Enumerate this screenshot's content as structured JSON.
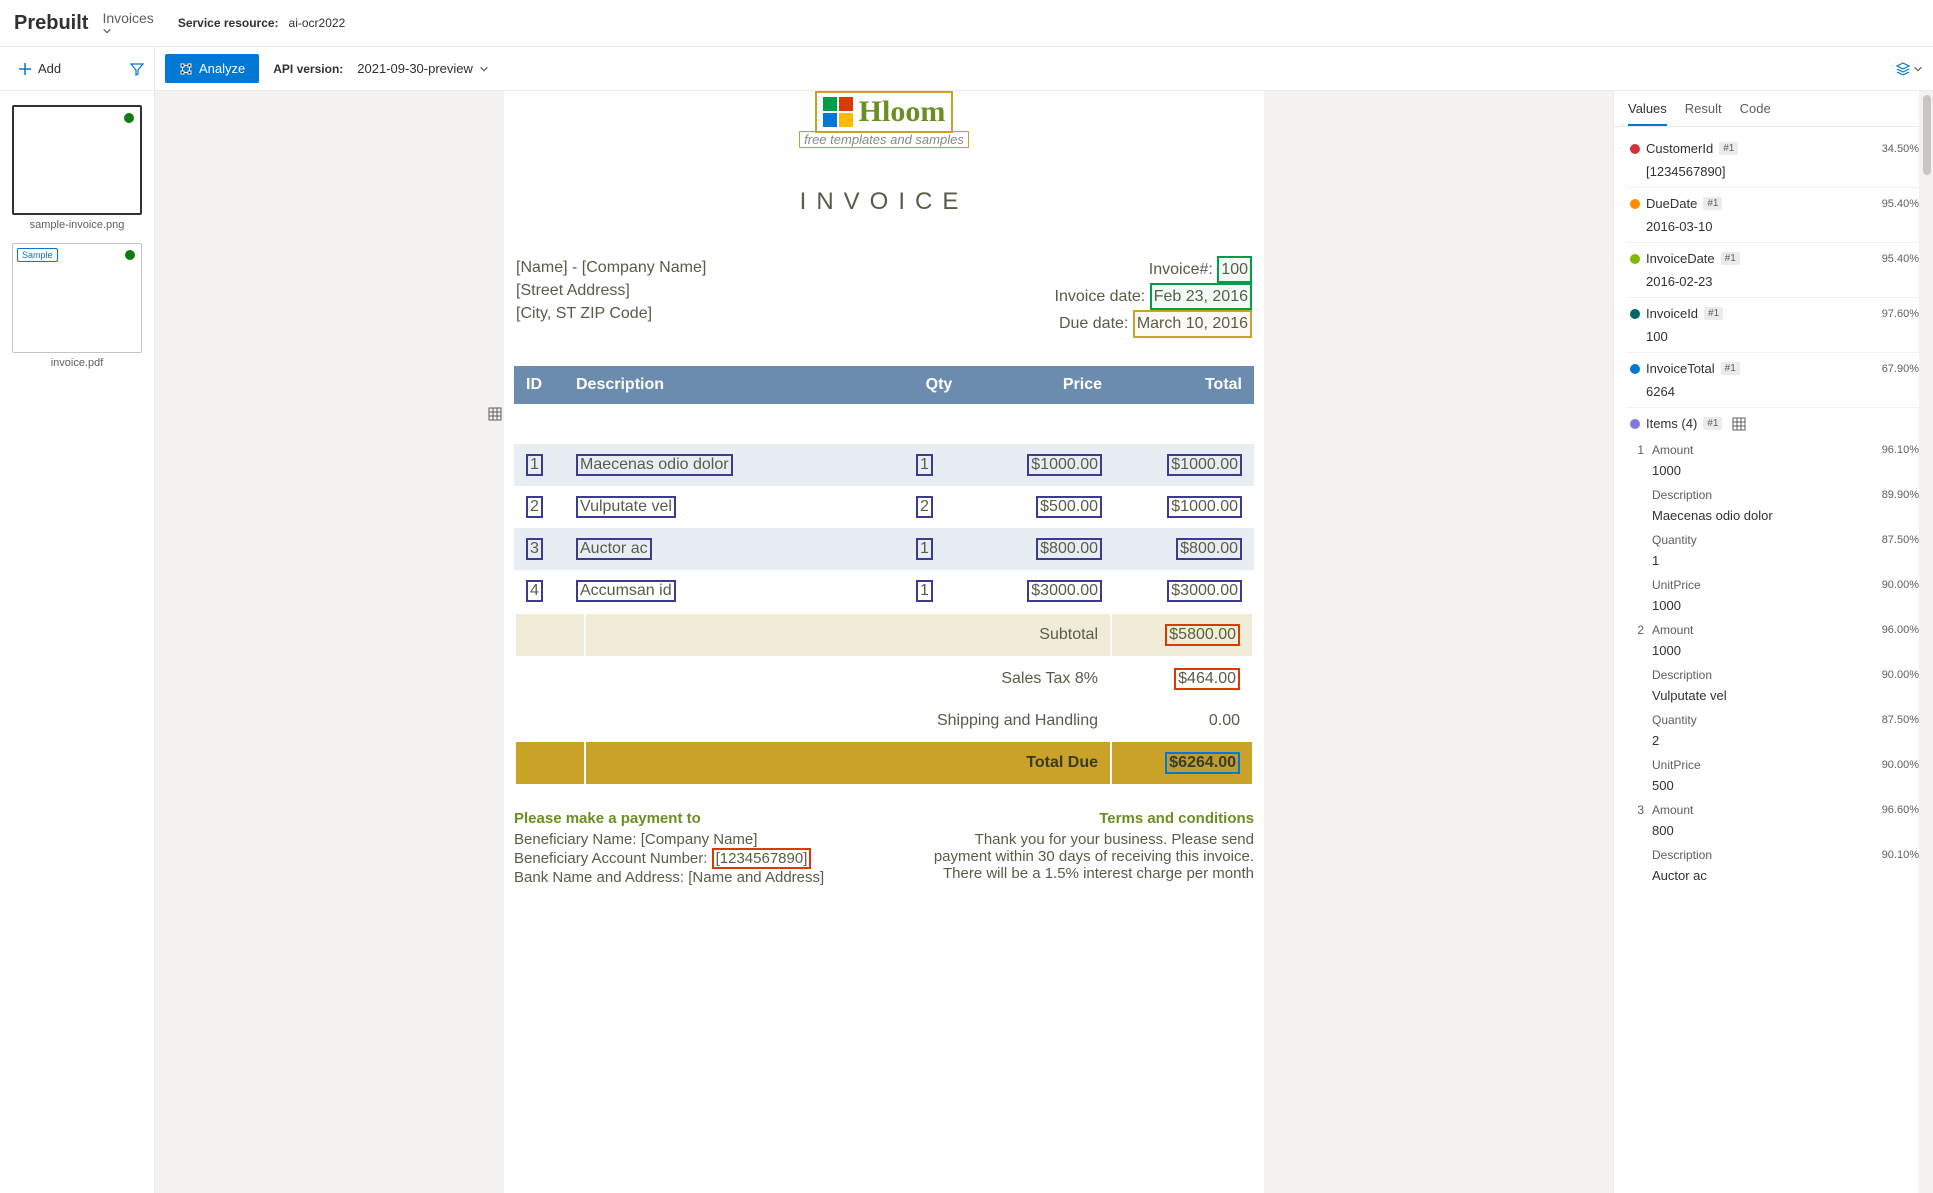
{
  "header": {
    "title": "Prebuilt",
    "crumb": "Invoices",
    "svc_label": "Service resource:",
    "svc_value": "ai-ocr2022"
  },
  "toolbar": {
    "add": "Add",
    "analyze": "Analyze",
    "api_label": "API version:",
    "api_value": "2021-09-30-preview"
  },
  "thumbs": [
    {
      "label": "sample-invoice.png",
      "selected": true,
      "sample": false
    },
    {
      "label": "invoice.pdf",
      "selected": false,
      "sample": true
    }
  ],
  "doc": {
    "logo_text": "Hloom",
    "logo_sub": "free templates and samples",
    "title": "INVOICE",
    "meta_left": [
      "[Name] - [Company Name]",
      "[Street Address]",
      "[City, ST ZIP Code]"
    ],
    "meta_right": {
      "inv_no_label": "Invoice#:",
      "inv_no": "100",
      "inv_date_label": "Invoice date:",
      "inv_date": "Feb 23, 2016",
      "due_label": "Due date:",
      "due": "March 10, 2016"
    },
    "columns": {
      "id": "ID",
      "desc": "Description",
      "qty": "Qty",
      "price": "Price",
      "total": "Total"
    },
    "rows": [
      {
        "id": "1",
        "desc": "Maecenas odio dolor",
        "qty": "1",
        "price": "$1000.00",
        "total": "$1000.00"
      },
      {
        "id": "2",
        "desc": "Vulputate vel",
        "qty": "2",
        "price": "$500.00",
        "total": "$1000.00"
      },
      {
        "id": "3",
        "desc": "Auctor ac",
        "qty": "1",
        "price": "$800.00",
        "total": "$800.00"
      },
      {
        "id": "4",
        "desc": "Accumsan id",
        "qty": "1",
        "price": "$3000.00",
        "total": "$3000.00"
      }
    ],
    "totals": {
      "subtotal_label": "Subtotal",
      "subtotal": "$5800.00",
      "tax_label": "Sales Tax 8%",
      "tax": "$464.00",
      "ship_label": "Shipping and Handling",
      "ship": "0.00",
      "due_label": "Total Due",
      "due": "$6264.00"
    },
    "footer_left": {
      "title": "Please make a payment to",
      "l1": "Beneficiary Name: [Company Name]",
      "l2a": "Beneficiary Account Number:",
      "l2b": "[1234567890]",
      "l3": "Bank Name and Address: [Name and Address]"
    },
    "footer_right": {
      "title": "Terms and conditions",
      "l1": "Thank you for your business. Please send",
      "l2": "payment within 30 days of receiving this invoice.",
      "l3": "There will be a 1.5% interest charge per month"
    }
  },
  "panel": {
    "tabs": {
      "values": "Values",
      "result": "Result",
      "code": "Code"
    },
    "fields": [
      {
        "color": "#d13438",
        "name": "CustomerId",
        "badge": "#1",
        "conf": "34.50%",
        "value": "[1234567890]"
      },
      {
        "color": "#ff8c00",
        "name": "DueDate",
        "badge": "#1",
        "conf": "95.40%",
        "value": "2016-03-10"
      },
      {
        "color": "#7fba00",
        "name": "InvoiceDate",
        "badge": "#1",
        "conf": "95.40%",
        "value": "2016-02-23"
      },
      {
        "color": "#006666",
        "name": "InvoiceId",
        "badge": "#1",
        "conf": "97.60%",
        "value": "100"
      },
      {
        "color": "#0078d4",
        "name": "InvoiceTotal",
        "badge": "#1",
        "conf": "67.90%",
        "value": "6264"
      }
    ],
    "items_label": "Items (4)",
    "items_badge": "#1",
    "items_color": "#8378de",
    "items": [
      {
        "num": "1",
        "subs": [
          {
            "name": "Amount",
            "conf": "96.10%",
            "value": "1000"
          },
          {
            "name": "Description",
            "conf": "89.90%",
            "value": "Maecenas odio dolor"
          },
          {
            "name": "Quantity",
            "conf": "87.50%",
            "value": "1"
          },
          {
            "name": "UnitPrice",
            "conf": "90.00%",
            "value": "1000"
          }
        ]
      },
      {
        "num": "2",
        "subs": [
          {
            "name": "Amount",
            "conf": "96.00%",
            "value": "1000"
          },
          {
            "name": "Description",
            "conf": "90.00%",
            "value": "Vulputate vel"
          },
          {
            "name": "Quantity",
            "conf": "87.50%",
            "value": "2"
          },
          {
            "name": "UnitPrice",
            "conf": "90.00%",
            "value": "500"
          }
        ]
      },
      {
        "num": "3",
        "subs": [
          {
            "name": "Amount",
            "conf": "96.60%",
            "value": "800"
          },
          {
            "name": "Description",
            "conf": "90.10%",
            "value": "Auctor ac"
          }
        ]
      }
    ]
  }
}
